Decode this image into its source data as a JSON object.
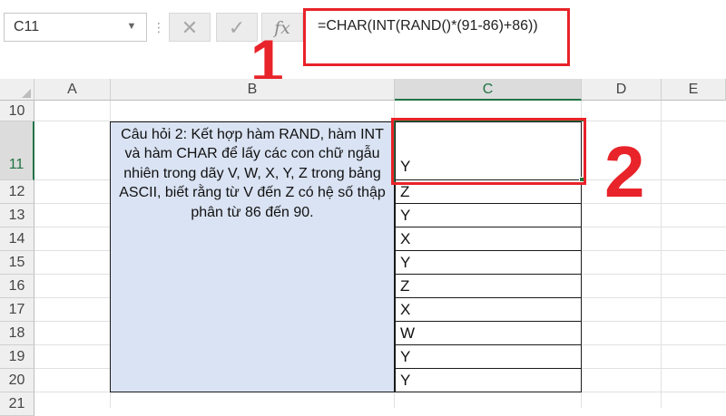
{
  "formula_bar": {
    "name_box": "C11",
    "dots": "⋮",
    "cancel_icon": "✕",
    "enter_icon": "✓",
    "fx_label": "fx",
    "formula": "=CHAR(INT(RAND()*(91-86)+86))"
  },
  "annotations": {
    "step1": "1",
    "step2": "2",
    "highlight_color": "#e8232a"
  },
  "columns": [
    "A",
    "B",
    "C",
    "D",
    "E"
  ],
  "rows": [
    "10",
    "11",
    "12",
    "13",
    "14",
    "15",
    "16",
    "17",
    "18",
    "19",
    "20",
    "21"
  ],
  "selected_cell": {
    "column": "C",
    "row": "11"
  },
  "question_text": "Câu hỏi 2: Kết hợp hàm RAND, hàm INT và hàm CHAR để lấy các con chữ ngẫu nhiên trong dãy V, W, X, Y, Z trong bảng ASCII, biết rằng từ V đến Z có hệ số thập phân từ 86 đến 90.",
  "results": [
    "Y",
    "Z",
    "Y",
    "X",
    "Y",
    "Z",
    "X",
    "W",
    "Y",
    "Y"
  ],
  "colors": {
    "question_fill": "#dae3f3",
    "selection_green": "#217346"
  }
}
